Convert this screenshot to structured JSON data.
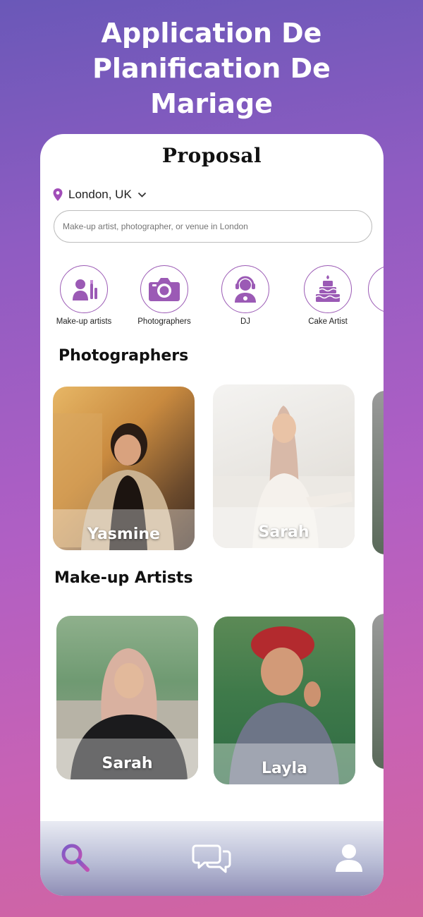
{
  "promo": {
    "line1": "Application De",
    "line2": "Planification De",
    "line3": "Mariage"
  },
  "app": {
    "brand": "Proposal",
    "location": "London, UK",
    "search_placeholder": "Make-up artist, photographer, or venue in London"
  },
  "categories": [
    {
      "label": "Make-up artists",
      "icon": "makeup-icon"
    },
    {
      "label": "Photographers",
      "icon": "camera-icon"
    },
    {
      "label": "DJ",
      "icon": "dj-icon"
    },
    {
      "label": "Cake Artist",
      "icon": "cake-icon"
    }
  ],
  "sections": {
    "photographers": {
      "title": "Photographers",
      "cards": [
        {
          "name": "Yasmine"
        },
        {
          "name": "Sarah"
        }
      ]
    },
    "makeup": {
      "title": "Make-up Artists",
      "cards": [
        {
          "name": "Sarah"
        },
        {
          "name": "Layla"
        }
      ]
    }
  },
  "nav": [
    {
      "icon": "search-icon",
      "active": true
    },
    {
      "icon": "chat-icon",
      "active": false
    },
    {
      "icon": "profile-icon",
      "active": false
    }
  ],
  "colors": {
    "accent": "#9b5ab5",
    "background_top": "#6a58b8",
    "background_bottom": "#d1659f"
  }
}
